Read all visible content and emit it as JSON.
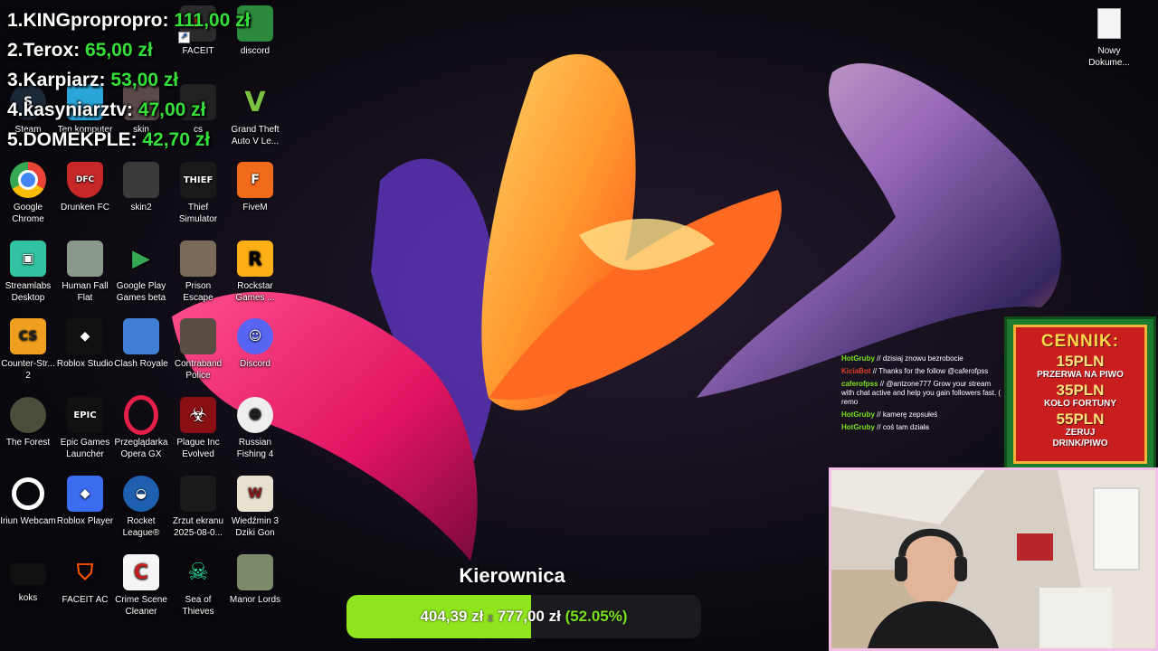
{
  "leaderboard": [
    {
      "rank": "1.",
      "name": "KINGpropropro:",
      "amount": "111,00 zł"
    },
    {
      "rank": "2.",
      "name": "Terox:",
      "amount": "65,00 zł"
    },
    {
      "rank": "3.",
      "name": "Karpiarz:",
      "amount": "53,00 zł"
    },
    {
      "rank": "4.",
      "name": "kasyniarztv:",
      "amount": "47,00 zł"
    },
    {
      "rank": "5.",
      "name": "DOMEKPLE:",
      "amount": "42,70 zł"
    }
  ],
  "desktop_icons": {
    "faceit": "FACEIT",
    "discord_top": "discord",
    "steam": "Steam",
    "ten_komputer": "Ten komputer",
    "skin": "skin",
    "cs": "cs",
    "gta": "Grand Theft Auto V Le...",
    "chrome": "Google Chrome",
    "drunken": "Drunken FC",
    "skin2": "skin2",
    "thief": "Thief Simulator",
    "fivem": "FiveM",
    "streamlabs": "Streamlabs Desktop",
    "human_fall": "Human Fall Flat",
    "google_play": "Google Play Games beta",
    "prison": "Prison Escape Simulator D...",
    "rockstar": "Rockstar Games ...",
    "counter": "Counter-Str... 2",
    "roblox_studio": "Roblox Studio",
    "clash": "Clash Royale",
    "contraband": "Contraband Police",
    "discord": "Discord",
    "forest": "The Forest",
    "epic": "Epic Games Launcher",
    "opera": "Przeglądarka Opera GX",
    "plague": "Plague Inc Evolved",
    "fishing": "Russian Fishing 4",
    "iriun": "Iriun Webcam",
    "roblox_player": "Roblox Player",
    "rocket": "Rocket League®",
    "zrzut": "Zrzut ekranu 2025-08-0...",
    "wiedzmin": "Wiedźmin 3 Dziki Gon",
    "koks": "koks",
    "faceit_ac": "FACEIT AC",
    "crime": "Crime Scene Cleaner",
    "sea": "Sea of Thieves",
    "manor": "Manor Lords",
    "nowy": "Nowy Dokume..."
  },
  "chat": [
    {
      "user": "HotGruby",
      "badge": "//",
      "text": "dzisiaj znowu bezrobocie"
    },
    {
      "user": "KiciaBot",
      "badge": "//",
      "text": "Thanks for the follow @caferofpss"
    },
    {
      "user": "caferofpss",
      "badge": "//",
      "text": "@antzone777 Grow your stream with chat active and help you gain followers fast. ( remo"
    },
    {
      "user": "HotGruby",
      "badge": "//",
      "text": "kamerę zepsułeś"
    },
    {
      "user": "HotGruby",
      "badge": "//",
      "text": "coś tam działa"
    }
  ],
  "price_board": {
    "title": "CENNIK:",
    "items": [
      {
        "price": "15PLN",
        "desc": "PRZERWA NA PIWO"
      },
      {
        "price": "35PLN",
        "desc": "KOŁO FORTUNY"
      },
      {
        "price": "55PLN",
        "desc": "ZERUJ DRINK/PIWO"
      }
    ]
  },
  "goal": {
    "title": "Kierownica",
    "current": "404,39 zł",
    "separator": "z",
    "target": "777,00 zł",
    "percent_text": "(52.05%)",
    "progress": 0.5205
  },
  "colors": {
    "leader_amount": "#35e03a",
    "goal_fill": "#8fe61c",
    "webcam_border": "#f4bfe6",
    "chat_user": "#7be21f"
  }
}
